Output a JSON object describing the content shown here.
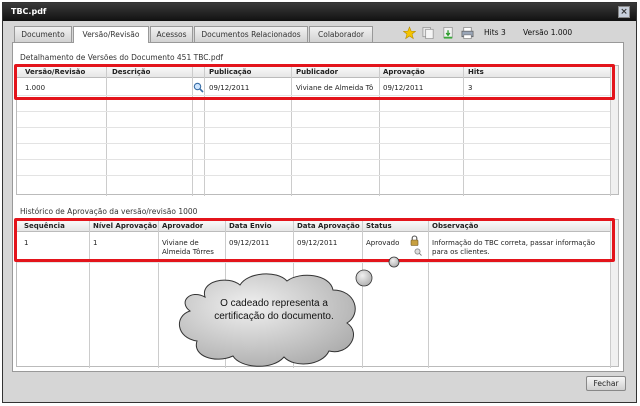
{
  "window": {
    "title": "TBC.pdf",
    "close_label": "×"
  },
  "tabs": [
    {
      "label": "Documento"
    },
    {
      "label": "Versão/Revisão"
    },
    {
      "label": "Acessos"
    },
    {
      "label": "Documentos Relacionados"
    },
    {
      "label": "Colaborador"
    }
  ],
  "toolbar": {
    "hits_label": "Hits 3",
    "version_label": "Versão 1.000"
  },
  "versions": {
    "section_title": "Detalhamento de Versões do Documento 451  TBC.pdf",
    "columns": [
      "Versão/Revisão",
      "Descrição",
      "",
      "Publicação",
      "Publicador",
      "Aprovação",
      "Hits"
    ],
    "rows": [
      [
        "1.000",
        "",
        "",
        "09/12/2011",
        "Viviane de Almeida Tô",
        "09/12/2011",
        "3"
      ]
    ]
  },
  "approvals": {
    "section_title": "Histórico de Aprovação da versão/revisão 1000",
    "columns": [
      "Sequência",
      "Nível Aprovação",
      "Aprovador",
      "Data Envio",
      "Data Aprovação",
      "Status",
      "Observação"
    ],
    "rows": [
      [
        "1",
        "1",
        "Viviane de Almeida Tôrres",
        "09/12/2011",
        "09/12/2011",
        "Aprovado",
        "Informação do TBC correta, passar informação para os clientes."
      ]
    ]
  },
  "callout": {
    "text": "O cadeado representa a certificação do documento."
  },
  "footer": {
    "close_button": "Fechar"
  },
  "colors": {
    "highlight": "#e3141b",
    "callout_fill": "#b5b5b5"
  }
}
